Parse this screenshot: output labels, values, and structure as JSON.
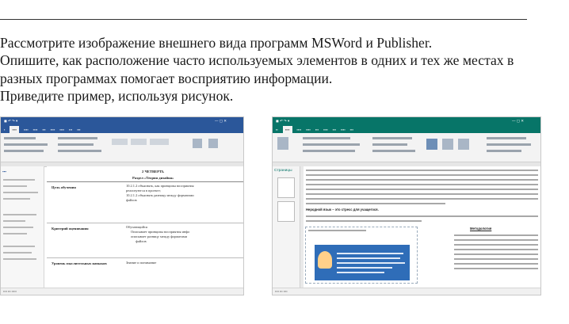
{
  "task": {
    "lines": [
      "Рассмотрите изображение внешнего вида программ MSWord и Publisher.",
      "Опишите, как расположение часто используемых элементов в одних и тех же местах в",
      "разных программах помогает восприятию информации.",
      "Приведите пример, используя рисунок."
    ]
  },
  "word": {
    "document": {
      "heading_main": "2 ЧЕТВЕРТЬ",
      "heading_section": "Раздел «Теория дизайна»",
      "rows": [
        {
          "label": "Цель обучения",
          "lines": [
            "10.2.1.2 объяснять, как принципы восприятия",
            "реализуются в проекте;",
            "10.2.1.2 объяснять разницу между форматами",
            "файлов"
          ]
        },
        {
          "label": "Критерий оценивания",
          "lines": [
            "Обучающийся",
            "Описывает принципы восприятия инфо",
            "описывает разницу между форматами",
            "файлов"
          ]
        },
        {
          "label": "Уровень мыслительных навыков",
          "lines": [
            "Знание и понимание"
          ]
        }
      ]
    }
  },
  "publisher": {
    "pages_label": "Страницы",
    "headings": {
      "topic": "Неродной язык – это стресс для учащегося.",
      "methods": "Методология"
    }
  }
}
